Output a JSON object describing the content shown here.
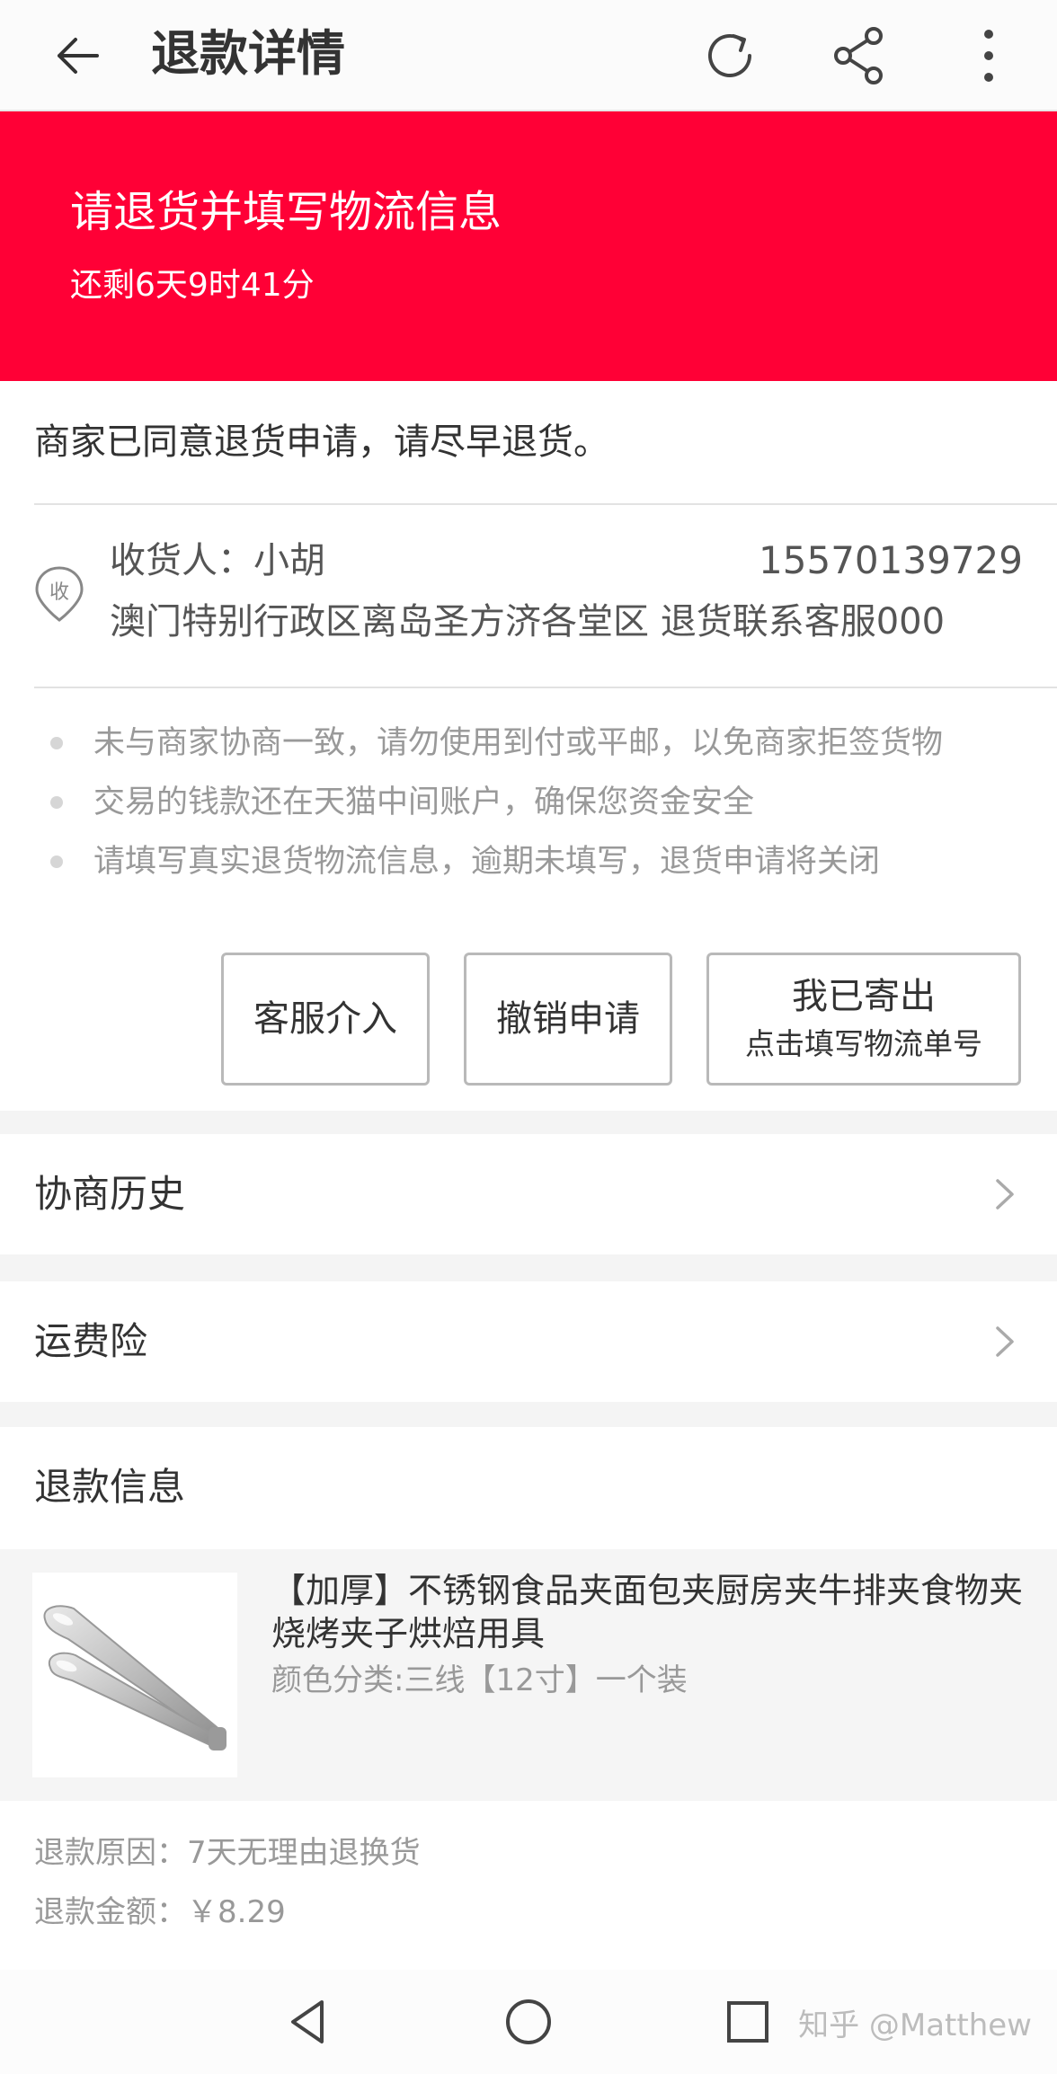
{
  "header": {
    "title": "退款详情",
    "icons": [
      "back-arrow-icon",
      "refresh-icon",
      "share-icon",
      "more-icon"
    ]
  },
  "banner": {
    "title": "请退货并填写物流信息",
    "countdown": "还剩6天9时41分",
    "color": "#ff0036"
  },
  "status": {
    "message": "商家已同意退货申请，请尽早退货。"
  },
  "address": {
    "receiver": "收货人：小胡",
    "phone": "15570139729",
    "detail": "澳门特别行政区离岛圣方济各堂区 退货联系客服000",
    "icon_char": "收"
  },
  "tips": [
    "未与商家协商一致，请勿使用到付或平邮，以免商家拒签货物",
    "交易的钱款还在天猫中间账户，确保您资金安全",
    "请填写真实退货物流信息，逾期未填写，退货申请将关闭"
  ],
  "actions": {
    "service": "客服介入",
    "cancel": "撤销申请",
    "shipped_main": "我已寄出",
    "shipped_sub": "点击填写物流单号"
  },
  "rows": {
    "history": "协商历史",
    "insurance": "运费险"
  },
  "refund_info": {
    "title": "退款信息",
    "product_name": "【加厚】不锈钢食品夹面包夹厨房夹牛排夹食物夹烧烤夹子烘焙用具",
    "product_spec": "颜色分类:三线【12寸】一个装",
    "reason": "退款原因：7天无理由退换货",
    "amount": "退款金额：￥8.29"
  },
  "navbar": {
    "watermark": "知乎 @Matthew",
    "icons": [
      "nav-back-icon",
      "nav-home-icon",
      "nav-recents-icon"
    ]
  }
}
